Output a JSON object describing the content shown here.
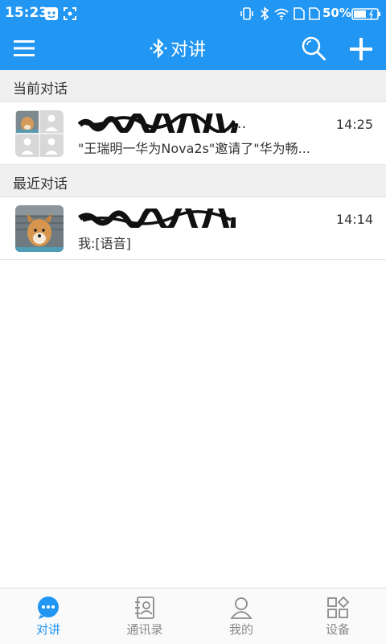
{
  "status_bar": {
    "time": "15:23",
    "battery_percent": "50%"
  },
  "header": {
    "title": "对讲",
    "icons": [
      "menu-icon",
      "bluetooth-icon",
      "search-icon",
      "add-icon"
    ]
  },
  "sections": [
    {
      "title": "当前对话",
      "conversation": {
        "name": "",
        "name_suffix": "...",
        "preview": "\"王瑞明一华为Nova2s\"邀请了\"华为畅...",
        "time": "14:25",
        "avatar": "group-avatar"
      }
    },
    {
      "title": "最近对话",
      "conversation": {
        "name": "",
        "preview": "我:[语音]",
        "time": "14:14",
        "avatar": "dog-avatar"
      }
    }
  ],
  "bottom_nav": {
    "items": [
      {
        "label": "对讲",
        "icon": "chat-icon",
        "active": true
      },
      {
        "label": "通讯录",
        "icon": "contacts-icon",
        "active": false
      },
      {
        "label": "我的",
        "icon": "profile-icon",
        "active": false
      },
      {
        "label": "设备",
        "icon": "devices-icon",
        "active": false
      }
    ]
  },
  "colors": {
    "primary": "#2196f3",
    "section_bg": "#f0f0f0",
    "inactive": "#8a8a8a"
  }
}
